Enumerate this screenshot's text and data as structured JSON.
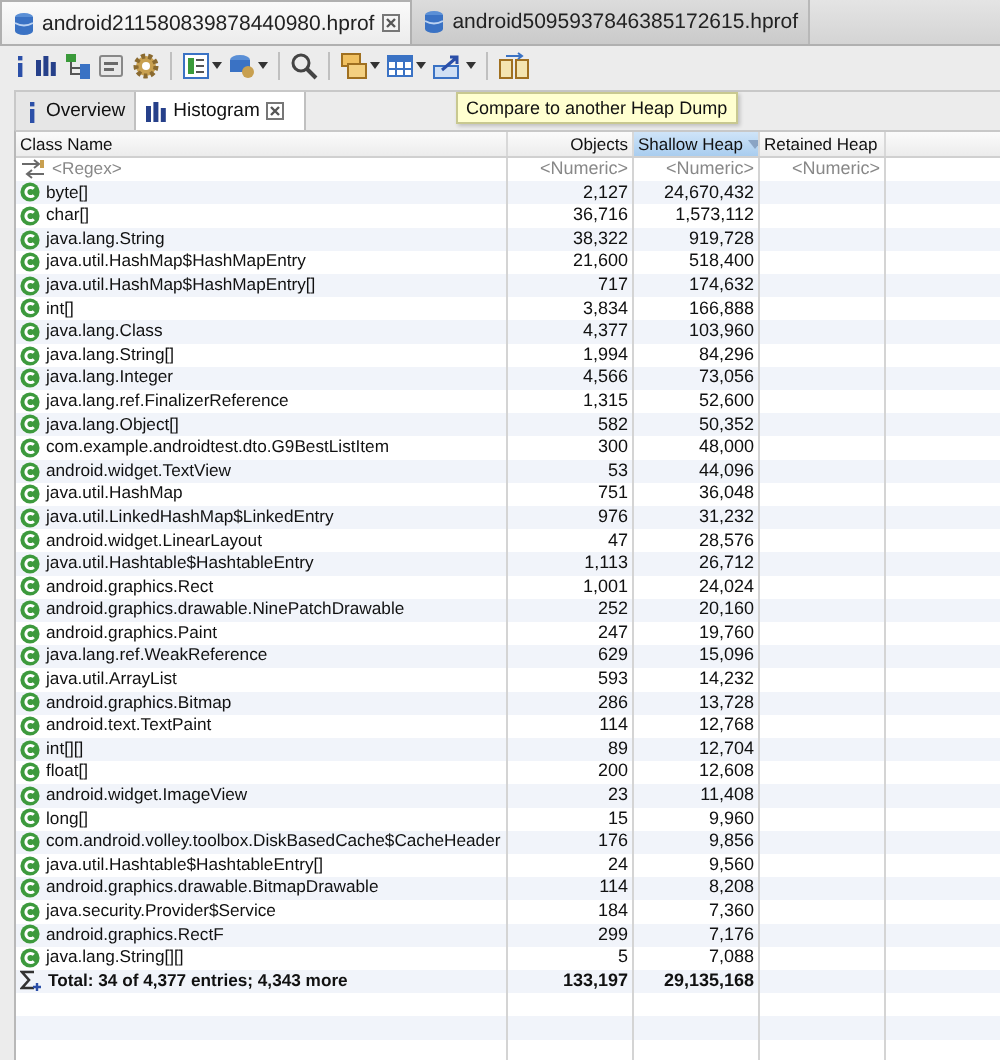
{
  "editor_tabs": [
    {
      "label": "android211580839878440980.hprof",
      "selected": true,
      "closable": true
    },
    {
      "label": "android5095937846385172615.hprof",
      "selected": false,
      "closable": false
    }
  ],
  "tooltip": "Compare to another Heap Dump",
  "view_tabs": [
    {
      "label": "Overview",
      "selected": false,
      "closable": false
    },
    {
      "label": "Histogram",
      "selected": true,
      "closable": true
    }
  ],
  "table": {
    "columns": [
      {
        "label": "Class Name",
        "sorted": false
      },
      {
        "label": "Objects",
        "sorted": false
      },
      {
        "label": "Shallow Heap",
        "sorted": true
      },
      {
        "label": "Retained Heap",
        "sorted": false
      }
    ],
    "filters": [
      "<Regex>",
      "<Numeric>",
      "<Numeric>",
      "<Numeric>"
    ],
    "rows": [
      {
        "class_name": "byte[]",
        "objects": "2,127",
        "shallow_heap": "24,670,432"
      },
      {
        "class_name": "char[]",
        "objects": "36,716",
        "shallow_heap": "1,573,112"
      },
      {
        "class_name": "java.lang.String",
        "objects": "38,322",
        "shallow_heap": "919,728"
      },
      {
        "class_name": "java.util.HashMap$HashMapEntry",
        "objects": "21,600",
        "shallow_heap": "518,400"
      },
      {
        "class_name": "java.util.HashMap$HashMapEntry[]",
        "objects": "717",
        "shallow_heap": "174,632"
      },
      {
        "class_name": "int[]",
        "objects": "3,834",
        "shallow_heap": "166,888"
      },
      {
        "class_name": "java.lang.Class",
        "objects": "4,377",
        "shallow_heap": "103,960"
      },
      {
        "class_name": "java.lang.String[]",
        "objects": "1,994",
        "shallow_heap": "84,296"
      },
      {
        "class_name": "java.lang.Integer",
        "objects": "4,566",
        "shallow_heap": "73,056"
      },
      {
        "class_name": "java.lang.ref.FinalizerReference",
        "objects": "1,315",
        "shallow_heap": "52,600"
      },
      {
        "class_name": "java.lang.Object[]",
        "objects": "582",
        "shallow_heap": "50,352"
      },
      {
        "class_name": "com.example.androidtest.dto.G9BestListItem",
        "objects": "300",
        "shallow_heap": "48,000"
      },
      {
        "class_name": "android.widget.TextView",
        "objects": "53",
        "shallow_heap": "44,096"
      },
      {
        "class_name": "java.util.HashMap",
        "objects": "751",
        "shallow_heap": "36,048"
      },
      {
        "class_name": "java.util.LinkedHashMap$LinkedEntry",
        "objects": "976",
        "shallow_heap": "31,232"
      },
      {
        "class_name": "android.widget.LinearLayout",
        "objects": "47",
        "shallow_heap": "28,576"
      },
      {
        "class_name": "java.util.Hashtable$HashtableEntry",
        "objects": "1,113",
        "shallow_heap": "26,712"
      },
      {
        "class_name": "android.graphics.Rect",
        "objects": "1,001",
        "shallow_heap": "24,024"
      },
      {
        "class_name": "android.graphics.drawable.NinePatchDrawable",
        "objects": "252",
        "shallow_heap": "20,160"
      },
      {
        "class_name": "android.graphics.Paint",
        "objects": "247",
        "shallow_heap": "19,760"
      },
      {
        "class_name": "java.lang.ref.WeakReference",
        "objects": "629",
        "shallow_heap": "15,096"
      },
      {
        "class_name": "java.util.ArrayList",
        "objects": "593",
        "shallow_heap": "14,232"
      },
      {
        "class_name": "android.graphics.Bitmap",
        "objects": "286",
        "shallow_heap": "13,728"
      },
      {
        "class_name": "android.text.TextPaint",
        "objects": "114",
        "shallow_heap": "12,768"
      },
      {
        "class_name": "int[][]",
        "objects": "89",
        "shallow_heap": "12,704"
      },
      {
        "class_name": "float[]",
        "objects": "200",
        "shallow_heap": "12,608"
      },
      {
        "class_name": "android.widget.ImageView",
        "objects": "23",
        "shallow_heap": "11,408"
      },
      {
        "class_name": "long[]",
        "objects": "15",
        "shallow_heap": "9,960"
      },
      {
        "class_name": "com.android.volley.toolbox.DiskBasedCache$CacheHeader",
        "objects": "176",
        "shallow_heap": "9,856"
      },
      {
        "class_name": "java.util.Hashtable$HashtableEntry[]",
        "objects": "24",
        "shallow_heap": "9,560"
      },
      {
        "class_name": "android.graphics.drawable.BitmapDrawable",
        "objects": "114",
        "shallow_heap": "8,208"
      },
      {
        "class_name": "java.security.Provider$Service",
        "objects": "184",
        "shallow_heap": "7,360"
      },
      {
        "class_name": "android.graphics.RectF",
        "objects": "299",
        "shallow_heap": "7,176"
      },
      {
        "class_name": "java.lang.String[][]",
        "objects": "5",
        "shallow_heap": "7,088"
      }
    ],
    "total": {
      "label": "Total: 34 of 4,377 entries; 4,343 more",
      "objects": "133,197",
      "shallow_heap": "29,135,168"
    }
  }
}
